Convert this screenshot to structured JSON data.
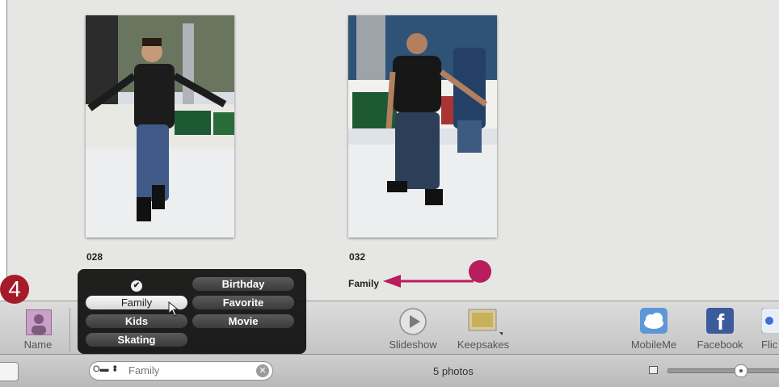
{
  "photos": [
    {
      "name": "028",
      "keyword": ""
    },
    {
      "name": "032",
      "keyword": "Family"
    }
  ],
  "popup": {
    "keywords": [
      {
        "label": "",
        "check": "✔"
      },
      {
        "label": "Birthday"
      },
      {
        "label": "Family"
      },
      {
        "label": "Favorite"
      },
      {
        "label": "Kids"
      },
      {
        "label": "Movie"
      },
      {
        "label": "Skating"
      }
    ]
  },
  "toolbar": {
    "name_label": "Name",
    "slideshow_label": "Slideshow",
    "keepsakes_label": "Keepsakes",
    "mobileme_label": "MobileMe",
    "facebook_label": "Facebook",
    "flickr_label": "Flic"
  },
  "statusbar": {
    "search_value": "Family",
    "search_keys": "O▬ ⬍",
    "photo_count": "5 photos"
  },
  "callout": {
    "step": "4"
  },
  "colors": {
    "step_marker": "#a51b2a",
    "arrow": "#b81d5e",
    "popup_bg": "#0f0f0f"
  },
  "icons": [
    "person-icon",
    "play-icon",
    "keepsakes-icon",
    "mobileme-cloud-icon",
    "facebook-icon",
    "clear-search-icon",
    "mouse-cursor-icon",
    "zoom-small-icon"
  ]
}
